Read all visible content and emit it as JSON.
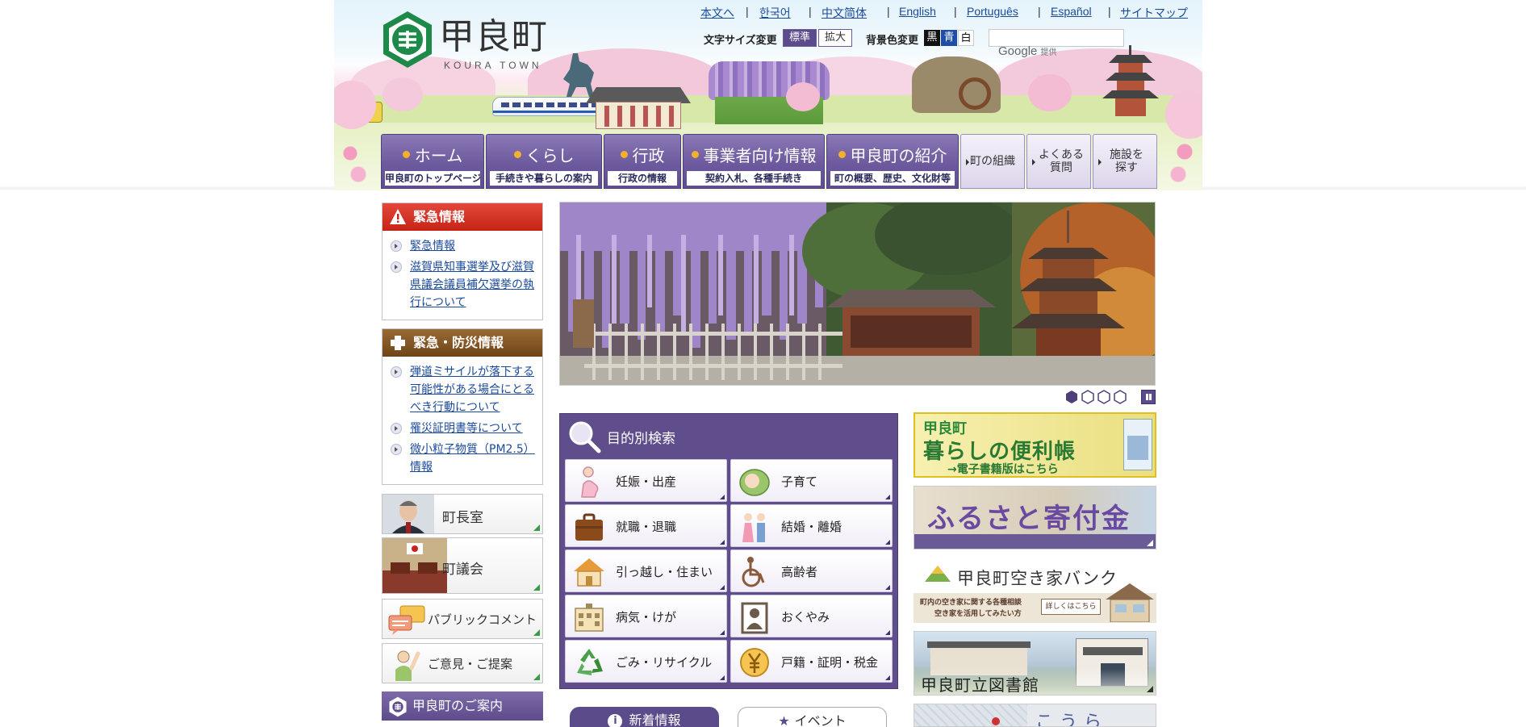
{
  "site": {
    "logo_jp": "甲良町",
    "logo_en": "KOURA TOWN"
  },
  "header_links": [
    {
      "label": "本文へ"
    },
    {
      "label": "한국어"
    },
    {
      "label": "中文简体"
    },
    {
      "label": "English"
    },
    {
      "label": "Português"
    },
    {
      "label": "Español"
    },
    {
      "label": "サイトマップ"
    }
  ],
  "accessibility": {
    "font_size_label": "文字サイズ変更",
    "font_standard": "標準",
    "font_large": "拡大",
    "bg_label": "背景色変更",
    "bg_black": "黒",
    "bg_blue": "青",
    "bg_white": "白"
  },
  "search": {
    "provider": "Google",
    "provider_suffix": "提供",
    "placeholder": ""
  },
  "nav": [
    {
      "label": "ホーム",
      "sub": "甲良町のトップページ"
    },
    {
      "label": "くらし",
      "sub": "手続きや暮らしの案内"
    },
    {
      "label": "行政",
      "sub": "行政の情報"
    },
    {
      "label": "事業者向け情報",
      "sub": "契約入札、各種手続き"
    },
    {
      "label": "甲良町の紹介",
      "sub": "町の概要、歴史、文化財等"
    }
  ],
  "nav_small": [
    {
      "label": "町の組織"
    },
    {
      "label": "よくある質問"
    },
    {
      "label": "施設を探す"
    }
  ],
  "emergency": {
    "title": "緊急情報",
    "items": [
      {
        "label": "緊急情報"
      },
      {
        "label": "滋賀県知事選挙及び滋賀県議会議員補欠選挙の執行について"
      }
    ]
  },
  "disaster": {
    "title": "緊急・防災情報",
    "items": [
      {
        "label": "弾道ミサイルが落下する可能性がある場合にとるべき行動について"
      },
      {
        "label": "罹災証明書等について"
      },
      {
        "label": "微小粒子物質（PM2.5）情報"
      }
    ]
  },
  "side_banners": [
    {
      "label": "町長室"
    },
    {
      "label": "町議会"
    },
    {
      "label": "パブリックコメント"
    },
    {
      "label": "ご意見・ご提案"
    }
  ],
  "guide": {
    "title": "甲良町のご案内"
  },
  "purpose": {
    "title": "目的別検索",
    "items": [
      {
        "label": "妊娠・出産"
      },
      {
        "label": "子育て"
      },
      {
        "label": "就職・退職"
      },
      {
        "label": "結婚・離婚"
      },
      {
        "label": "引っ越し・住まい"
      },
      {
        "label": "高齢者"
      },
      {
        "label": "病気・けが"
      },
      {
        "label": "おくやみ"
      },
      {
        "label": "ごみ・リサイクル"
      },
      {
        "label": "戸籍・証明・税金"
      }
    ]
  },
  "right_banners": {
    "benri_top": "甲良町",
    "benri_main": "暮らしの便利帳",
    "benri_sub": "→電子書籍版はこちら",
    "furusato": "ふるさと寄付金",
    "akiya_title": "甲良町空き家バンク",
    "akiya_line1": "町内の空き家に関する各種相談",
    "akiya_line2": "空き家を活用してみたい方",
    "akiya_btn": "詳しくはこちら",
    "library": "甲良町立図書館",
    "bottom_partial": "こうら"
  },
  "tabs": [
    {
      "label": "新着情報"
    },
    {
      "label": "イベント"
    }
  ],
  "colors": {
    "brand_purple": "#5c4b8a",
    "emergency_red": "#c62316",
    "disaster_brown": "#6e4518",
    "link_blue": "#1a4a9c",
    "logo_green": "#1e8a4a"
  }
}
